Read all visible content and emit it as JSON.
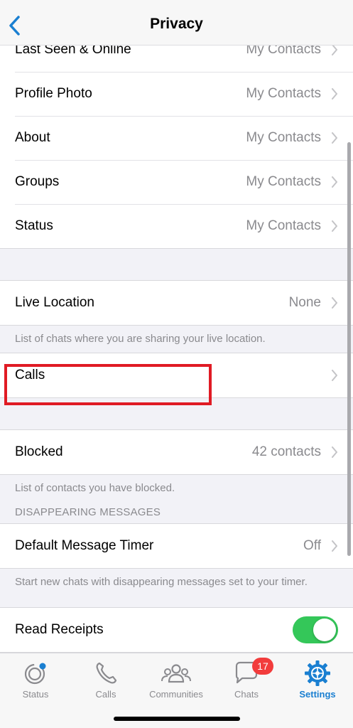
{
  "header": {
    "title": "Privacy",
    "back_icon": "chevron-left-icon"
  },
  "colors": {
    "accent": "#1a7fd1",
    "toggle_on": "#34c759",
    "highlight": "#e01b24",
    "badge": "#f23c3c"
  },
  "group1": [
    {
      "label": "Last Seen & Online",
      "value": "My Contacts"
    },
    {
      "label": "Profile Photo",
      "value": "My Contacts"
    },
    {
      "label": "About",
      "value": "My Contacts"
    },
    {
      "label": "Groups",
      "value": "My Contacts"
    },
    {
      "label": "Status",
      "value": "My Contacts"
    }
  ],
  "live_location": {
    "label": "Live Location",
    "value": "None",
    "footnote": "List of chats where you are sharing your live location."
  },
  "calls": {
    "label": "Calls"
  },
  "blocked": {
    "label": "Blocked",
    "value": "42 contacts",
    "footnote": "List of contacts you have blocked."
  },
  "disappearing": {
    "section_title": "DISAPPEARING MESSAGES",
    "label": "Default Message Timer",
    "value": "Off",
    "footnote": "Start new chats with disappearing messages set to your timer."
  },
  "read_receipts": {
    "label": "Read Receipts",
    "enabled": true
  },
  "tabbar": {
    "tabs": [
      {
        "label": "Status",
        "icon": "status-icon"
      },
      {
        "label": "Calls",
        "icon": "phone-icon"
      },
      {
        "label": "Communities",
        "icon": "communities-icon"
      },
      {
        "label": "Chats",
        "icon": "chat-bubbles-icon",
        "badge": "17"
      },
      {
        "label": "Settings",
        "icon": "settings-gear-icon",
        "active": true
      }
    ]
  }
}
